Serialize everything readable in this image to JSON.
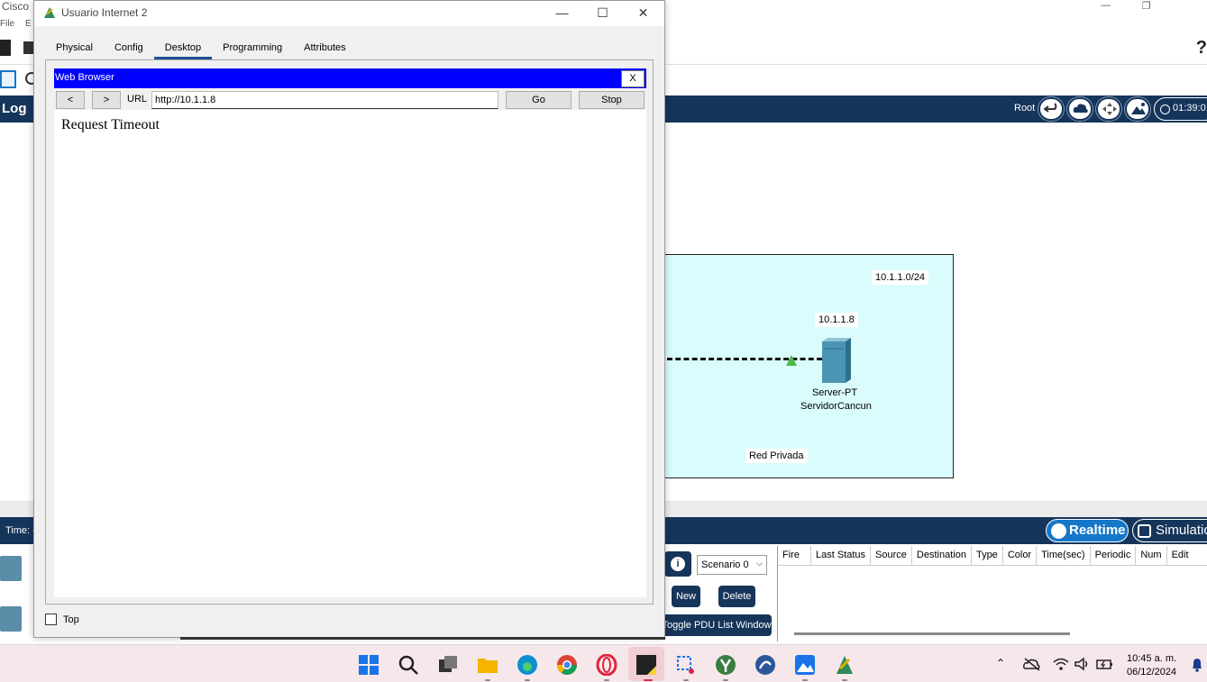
{
  "background_app": {
    "title": "Cisco",
    "menu": [
      "File",
      "E"
    ],
    "help_symbol": "?",
    "nav_label": "Log",
    "root_label": "Root",
    "clock": "01:39:0",
    "time_label": "Time: (",
    "realtime_label": "Realtime",
    "simulation_label": "Simulatio",
    "canvas": {
      "network_label": "10.1.1.0/24",
      "ip_label": "10.1.1.8",
      "device_type": "Server-PT",
      "device_name": "ServidorCancun",
      "zone_label": "Red Privada"
    },
    "scenario": "Scenario 0",
    "new_label": "New",
    "delete_label": "Delete",
    "toggle_pdu_label": "Toggle PDU List Window",
    "pdu_columns": [
      "Fire",
      "Last Status",
      "Source",
      "Destination",
      "Type",
      "Color",
      "Time(sec)",
      "Periodic",
      "Num",
      "Edit"
    ]
  },
  "dialog": {
    "title": "Usuario Internet 2",
    "controls": {
      "minimize": "—",
      "maximize": "☐",
      "close": "✕"
    },
    "tabs": [
      "Physical",
      "Config",
      "Desktop",
      "Programming",
      "Attributes"
    ],
    "active_tab": "Desktop",
    "browser": {
      "title": "Web Browser",
      "close_label": "X",
      "back_label": "<",
      "forward_label": ">",
      "url_label": "URL",
      "url_value": "http://10.1.1.8",
      "go_label": "Go",
      "stop_label": "Stop",
      "page_text": "Request Timeout"
    },
    "top_checkbox_label": "Top"
  },
  "taskbar": {
    "time": "10:45 a. m.",
    "date": "06/12/2024"
  },
  "colors": {
    "browser_title_bg": "#0000ff",
    "navy": "#16355a",
    "realtime_blue": "#1577c8",
    "cluster_bg": "#dbfcfd"
  }
}
